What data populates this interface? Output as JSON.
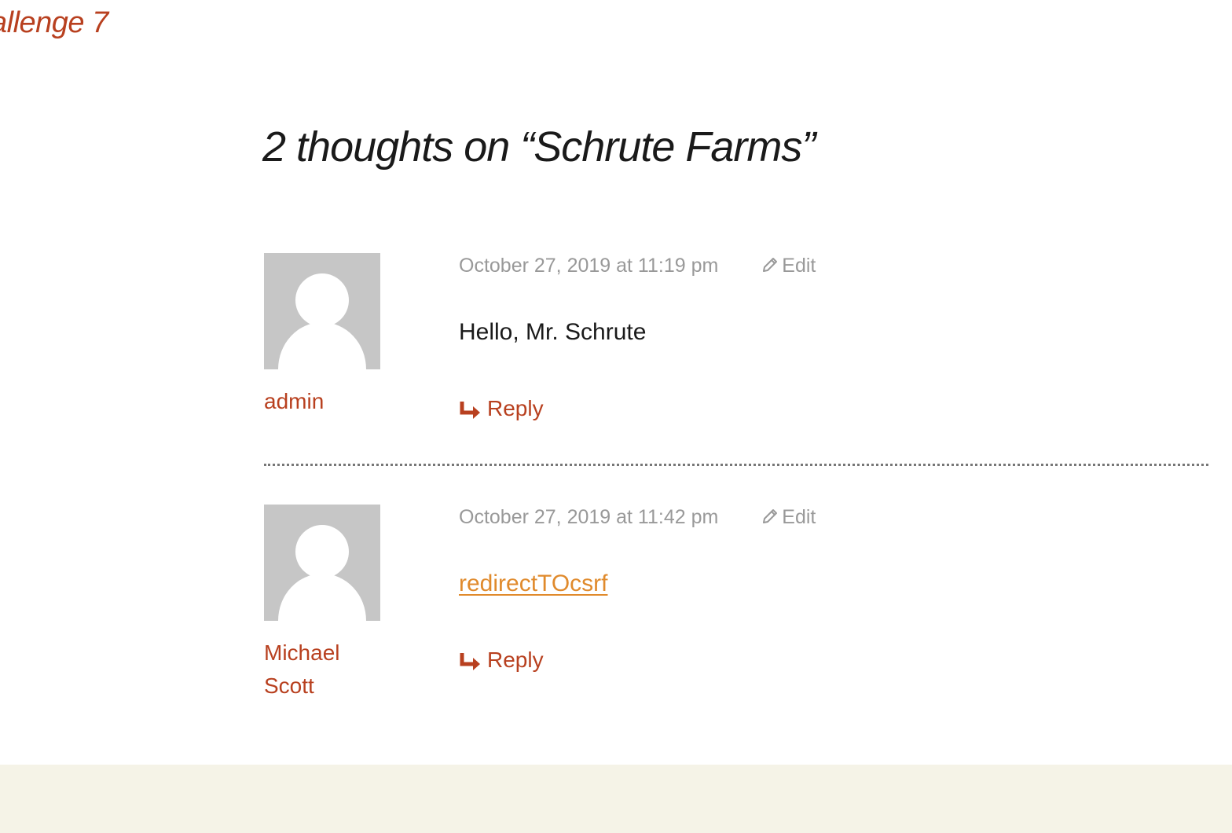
{
  "header": {
    "site_link_fragment": "allenge 7"
  },
  "comments_section": {
    "title": "2 thoughts on “Schrute Farms”",
    "comments": [
      {
        "author": "admin",
        "date": "October 27, 2019 at 11:19 pm",
        "edit_label": "Edit",
        "content": "Hello, Mr. Schrute",
        "content_is_link": false,
        "reply_label": "Reply"
      },
      {
        "author": "Michael Scott",
        "date": "October 27, 2019 at 11:42 pm",
        "edit_label": "Edit",
        "content": "redirectTOcsrf",
        "content_is_link": true,
        "reply_label": "Reply"
      }
    ]
  },
  "icons": {
    "avatar": "default-user-avatar-icon",
    "edit": "pencil-icon",
    "reply": "reply-arrow-icon"
  },
  "colors": {
    "accent": "#b8401f",
    "link": "#e08a2c",
    "meta": "#999999",
    "avatar_bg": "#c6c6c6",
    "footer_bg": "#f5f3e7"
  }
}
